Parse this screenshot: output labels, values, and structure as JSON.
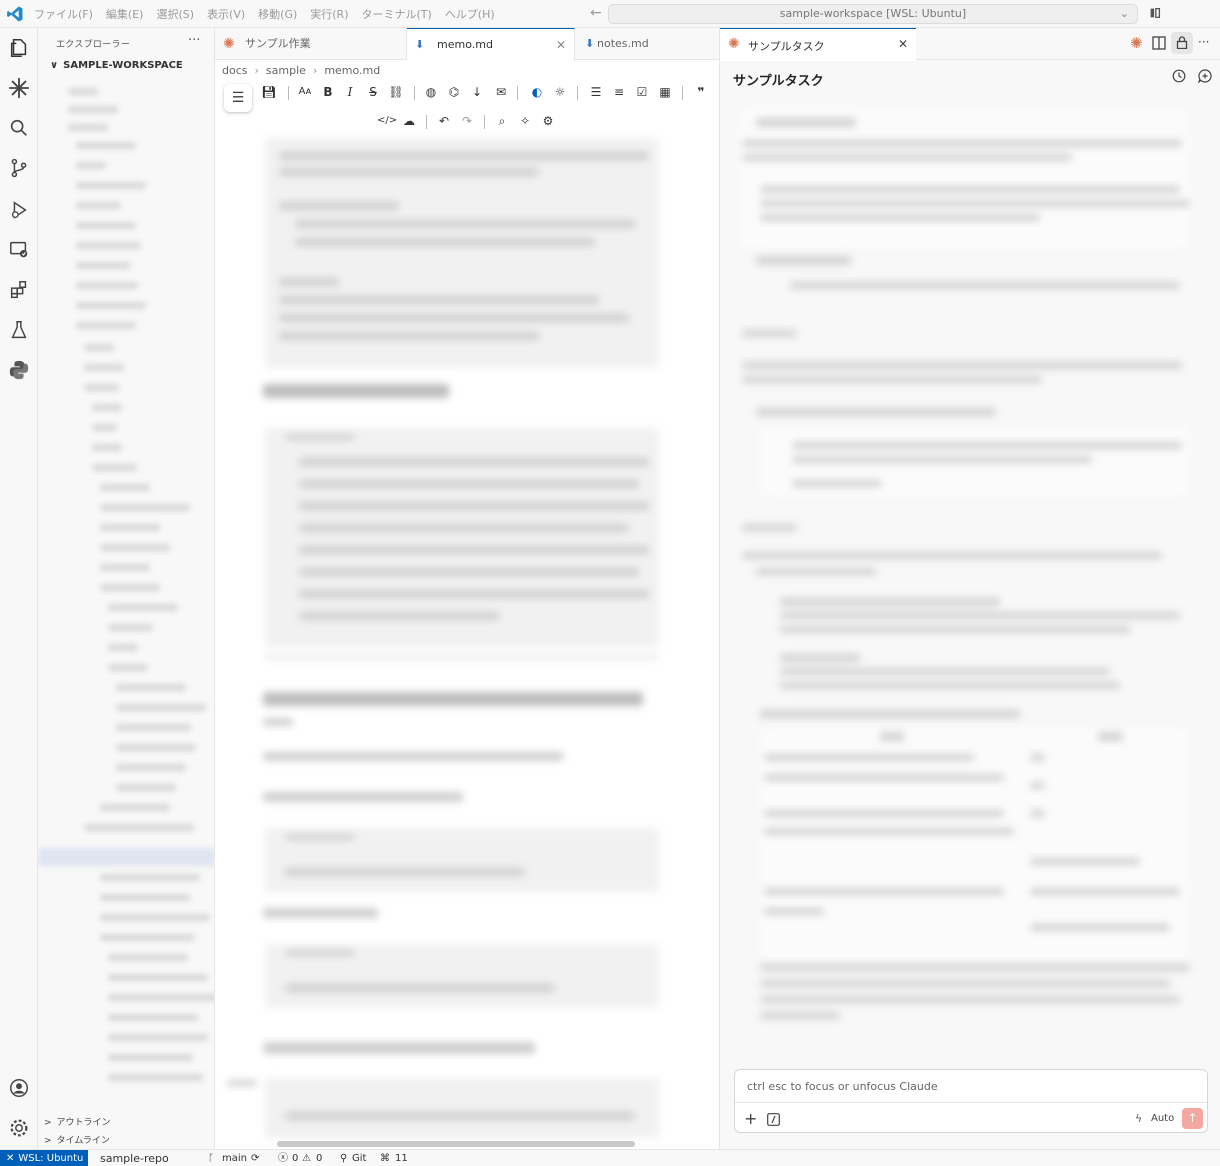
{
  "titlebar": {
    "menu": [
      "ファイル(F)",
      "編集(E)",
      "選択(S)",
      "表示(V)",
      "移動(G)",
      "実行(R)",
      "ターミナル(T)",
      "ヘルプ(H)"
    ],
    "back_arrow": "←",
    "search_text": "sample-workspace [WSL: Ubuntu]",
    "chevron": "⌄"
  },
  "sidebar": {
    "header": "エクスプローラー",
    "more": "···",
    "workspace": "SAMPLE-WORKSPACE",
    "workspace_chevron": "∨",
    "outline": "アウトライン",
    "timeline": "タイムライン",
    "collapsed_chevron": ">"
  },
  "editor": {
    "tabs": [
      {
        "label": "サンプル作業",
        "icon": "claude-spark-icon"
      },
      {
        "label": "memo.md",
        "icon": "markdown-icon",
        "close": "✕"
      },
      {
        "label": "notes.md",
        "icon": "markdown-icon"
      }
    ],
    "breadcrumb": [
      "docs",
      "sample",
      "memo.md"
    ],
    "breadcrumb_sep": "›",
    "hamburger": "☰"
  },
  "chat": {
    "tab_label": "サンプルタスク",
    "tab_close": "✕",
    "title": "サンプルタスク",
    "input_placeholder": "ctrl esc to focus or unfocus Claude",
    "add": "+",
    "mode_label": "Auto",
    "send": "↑"
  },
  "statusbar": {
    "remote": "WSL: Ubuntu",
    "repo": "sample-repo",
    "branch": "main",
    "errors": "0",
    "warnings": "0",
    "git": "Git",
    "ports": "11"
  },
  "colors": {
    "accent": "#005fb8",
    "claude": "#d97757",
    "send_button": "#f4a7a0"
  }
}
